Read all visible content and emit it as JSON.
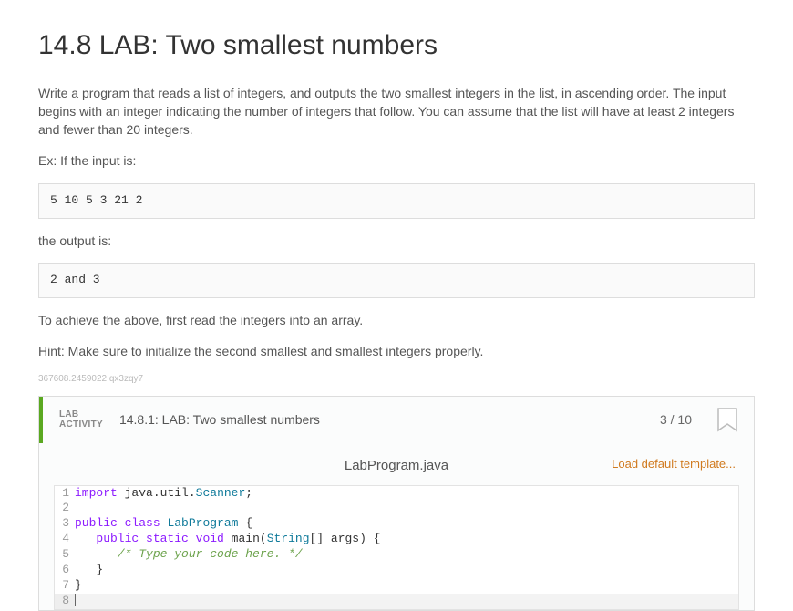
{
  "heading": "14.8 LAB: Two smallest numbers",
  "para1": "Write a program that reads a list of integers, and outputs the two smallest integers in the list, in ascending order. The input begins with an integer indicating the number of integers that follow. You can assume that the list will have at least 2 integers and fewer than 20 integers.",
  "exlabel": "Ex: If the input is:",
  "inputSample": "5 10 5 3 21 2",
  "outputLabel": "the output is:",
  "outputSample": "2 and 3",
  "para2": "To achieve the above, first read the integers into an array.",
  "para3": "Hint: Make sure to initialize the second smallest and smallest integers properly.",
  "watermark": "367608.2459022.qx3zqy7",
  "activity": {
    "tagLine1": "LAB",
    "tagLine2": "ACTIVITY",
    "title": "14.8.1: LAB: Two smallest numbers",
    "score": "3 / 10",
    "filename": "LabProgram.java",
    "loadDefault": "Load default template..."
  },
  "code": {
    "lines": [
      {
        "n": "1",
        "tokens": [
          [
            "kw",
            "import"
          ],
          [
            "plain",
            " java"
          ],
          [
            "plain",
            "."
          ],
          [
            "plain",
            "util"
          ],
          [
            "plain",
            "."
          ],
          [
            "cls",
            "Scanner"
          ],
          [
            "plain",
            ";"
          ]
        ]
      },
      {
        "n": "2",
        "tokens": []
      },
      {
        "n": "3",
        "tokens": [
          [
            "kw",
            "public"
          ],
          [
            "plain",
            " "
          ],
          [
            "kw",
            "class"
          ],
          [
            "plain",
            " "
          ],
          [
            "cls",
            "LabProgram"
          ],
          [
            "plain",
            " {"
          ]
        ]
      },
      {
        "n": "4",
        "tokens": [
          [
            "plain",
            "   "
          ],
          [
            "kw",
            "public"
          ],
          [
            "plain",
            " "
          ],
          [
            "kw",
            "static"
          ],
          [
            "plain",
            " "
          ],
          [
            "kw",
            "void"
          ],
          [
            "plain",
            " main("
          ],
          [
            "cls",
            "String"
          ],
          [
            "plain",
            "[] args) {"
          ]
        ]
      },
      {
        "n": "5",
        "tokens": [
          [
            "plain",
            "      "
          ],
          [
            "com",
            "/* Type your code here. */"
          ]
        ]
      },
      {
        "n": "6",
        "tokens": [
          [
            "plain",
            "   }"
          ]
        ]
      },
      {
        "n": "7",
        "tokens": [
          [
            "plain",
            "}"
          ]
        ]
      },
      {
        "n": "8",
        "tokens": [],
        "cursor": true
      }
    ]
  }
}
